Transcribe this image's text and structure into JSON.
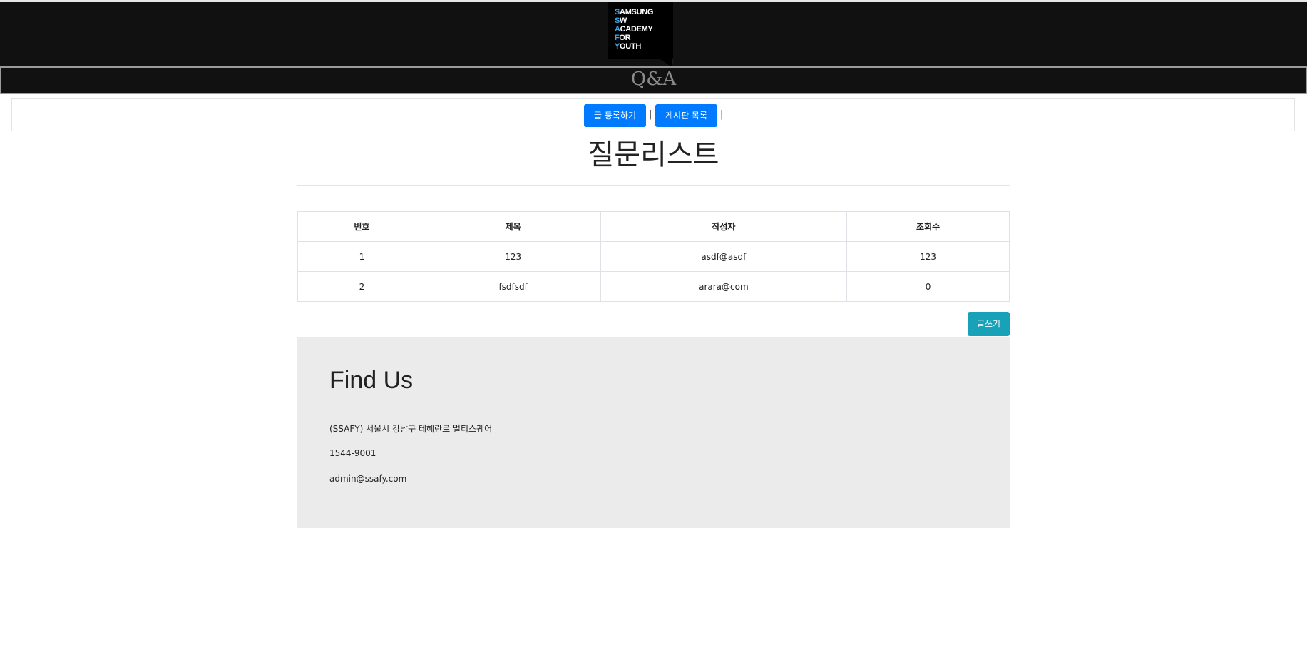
{
  "header": {
    "logo_lines": [
      "SAMSUNG",
      "SW",
      "ACADEMY",
      "FOR",
      "YOUTH"
    ],
    "page_title": "Q&A"
  },
  "nav": {
    "register_label": "글 등록하기",
    "separator": "|",
    "list_label": "게시판 목록"
  },
  "main": {
    "heading": "질문리스트",
    "table": {
      "headers": [
        "번호",
        "제목",
        "작성자",
        "조회수"
      ],
      "rows": [
        [
          "1",
          "123",
          "asdf@asdf",
          "123"
        ],
        [
          "2",
          "fsdfsdf",
          "arara@com",
          "0"
        ]
      ]
    },
    "write_label": "글쓰기"
  },
  "footer": {
    "title": "Find Us",
    "address": "(SSAFY) 서울시 강남구 테헤란로 멀티스퀘어",
    "phone": "1544-9001",
    "email": "admin@ssafy.com"
  },
  "colors": {
    "header_bg": "#111111",
    "primary": "#007bff",
    "info": "#17a2b8",
    "footer_bg": "#ebebeb",
    "logo_highlight": "#3aa7e8"
  }
}
